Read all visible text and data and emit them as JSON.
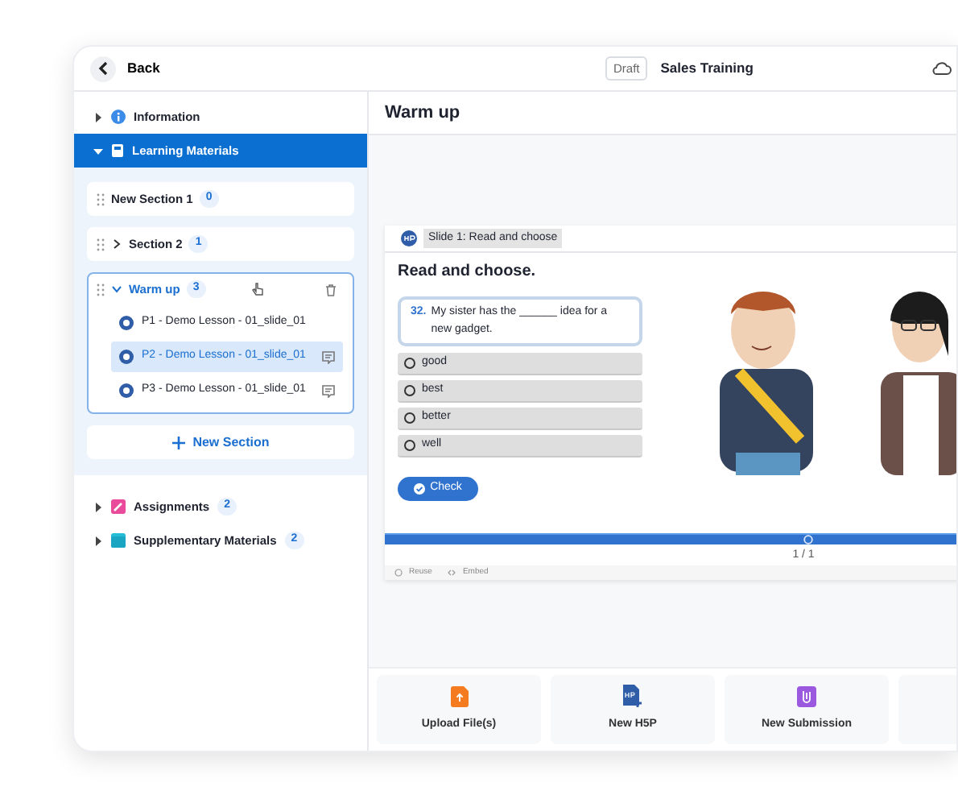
{
  "header": {
    "back_label": "Back",
    "status_badge": "Draft",
    "title": "Sales Training"
  },
  "sidebar": {
    "items": [
      {
        "kind": "info",
        "label": "Information",
        "expanded": false,
        "selected": false
      },
      {
        "kind": "book",
        "label": "Learning Materials",
        "expanded": true,
        "selected": true,
        "sections": [
          {
            "label": "New Section 1",
            "count": "0",
            "selected": false
          },
          {
            "label": "Section 2",
            "count": "1",
            "expanded": false,
            "selected": false
          },
          {
            "label": "Warm up",
            "count": "3",
            "expanded": true,
            "selected": true,
            "lessons": [
              {
                "label": "P1 - Demo Lesson - 01_slide_01",
                "selected": false,
                "comment": false
              },
              {
                "label": "P2 - Demo Lesson - 01_slide_01",
                "selected": true,
                "comment": true
              },
              {
                "label": "P3 - Demo Lesson - 01_slide_01",
                "selected": false,
                "comment": true
              }
            ]
          }
        ],
        "new_section_label": "New Section"
      },
      {
        "kind": "assignment",
        "label": "Assignments",
        "count": "2",
        "expanded": false,
        "selected": false
      },
      {
        "kind": "supplement",
        "label": "Supplementary Materials",
        "count": "2",
        "expanded": false,
        "selected": false
      }
    ]
  },
  "main": {
    "title": "Warm up",
    "embed": {
      "slide_title": "Slide 1: Read and choose",
      "heading": "Read and choose.",
      "question_number": "32.",
      "question": "My sister has the ______ idea for a new gadget.",
      "options": [
        {
          "label": "good",
          "selected": false
        },
        {
          "label": "best",
          "selected": false
        },
        {
          "label": "better",
          "selected": false
        },
        {
          "label": "well",
          "selected": false
        }
      ],
      "check_label": "Check",
      "progress": {
        "level": 1
      },
      "pager": "1 / 1",
      "footer_links": [
        "Reuse",
        "Embed"
      ]
    },
    "actions": [
      {
        "kind": "upload",
        "label": "Upload File(s)"
      },
      {
        "kind": "h5p",
        "label": "New H5P"
      },
      {
        "kind": "submission",
        "label": "New Submission"
      },
      {
        "kind": "blank"
      }
    ]
  }
}
